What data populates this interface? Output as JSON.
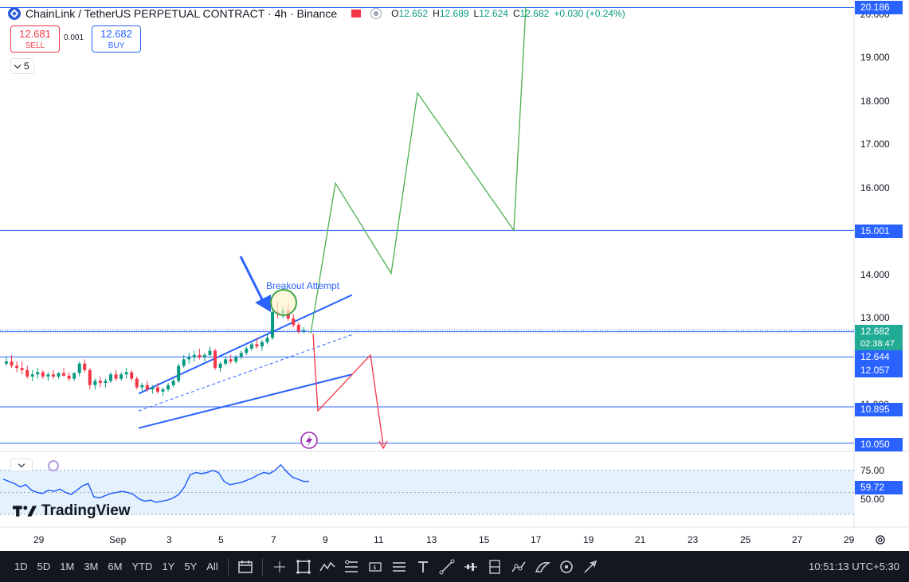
{
  "header": {
    "symbol_title": "ChainLink / TetherUS PERPETUAL CONTRACT · 4h · Binance",
    "ohlc": [
      {
        "label": "O",
        "value": "12.652"
      },
      {
        "label": "H",
        "value": "12.689"
      },
      {
        "label": "L",
        "value": "12.624"
      },
      {
        "label": "C",
        "value": "12.682"
      }
    ],
    "change": "+0.030 (+0.24%)"
  },
  "trade": {
    "sell_price": "12.681",
    "sell_label": "SELL",
    "spread": "0.001",
    "buy_price": "12.682",
    "buy_label": "BUY"
  },
  "interval_count": "5",
  "annotation": "Breakout Attempt",
  "price_axis": {
    "ticks": [
      "20.000",
      "19.000",
      "18.000",
      "17.000",
      "16.000",
      "14.000",
      "13.000",
      "11.000",
      "10.050"
    ],
    "tag_top": "20.186",
    "tag_15": "15.001",
    "tag_current": "12.682",
    "countdown": "02:38:47",
    "tag_12644": "12.644",
    "tag_12057": "12.057",
    "tag_10895": "10.895",
    "tag_10050": "10.050"
  },
  "rsi": {
    "tick_75": "75.00",
    "tick_50": "50.00",
    "value": "59.72",
    "value_color": "#2962ff",
    "band_color": "#e3f2fd"
  },
  "brand": {
    "name": "TradingView"
  },
  "time_axis": [
    "29",
    "Sep",
    "3",
    "5",
    "7",
    "9",
    "11",
    "13",
    "15",
    "17",
    "19",
    "21",
    "23",
    "25",
    "27",
    "29"
  ],
  "toolbar": {
    "timeframes": [
      "1D",
      "5D",
      "1M",
      "3M",
      "6M",
      "YTD",
      "1Y",
      "5Y",
      "All"
    ],
    "clock": "10:51:13 UTC+5:30",
    "tools": [
      "calendar-range-icon",
      "cursor-icon",
      "crosshair-select-icon",
      "trendline-pattern-icon",
      "fib-retracement-icon",
      "parallel-channel-icon",
      "gann-fan-icon",
      "text-tool-icon",
      "line-tool-icon",
      "forecast-icon",
      "position-icon",
      "path-icon",
      "brush-icon",
      "measure-icon",
      "arrow-tool-icon"
    ]
  },
  "colors": {
    "up": "#089981",
    "down": "#f23645",
    "accent": "#2962ff",
    "projection_up": "#4caf50",
    "projection_down": "#f23645"
  },
  "chart_data": {
    "type": "candlestick",
    "symbol": "ChainLink / TetherUS PERPETUAL CONTRACT",
    "interval": "4h",
    "exchange": "Binance",
    "ylim": [
      9.95,
      20.25
    ],
    "horizontal_levels": [
      20.186,
      15.001,
      12.644,
      12.057,
      10.895,
      10.05
    ],
    "channel_upper": [
      [
        11.2,
        13.3
      ],
      [
        13.0,
        13.5
      ]
    ],
    "channel_lower": [
      [
        11.35,
        12.5
      ],
      [
        10.4,
        11.65
      ]
    ],
    "projection_up_path": [
      12.6,
      16.1,
      14.0,
      18.2,
      15.0,
      20.2
    ],
    "projection_down_path": [
      12.6,
      10.8,
      12.1,
      10.0
    ],
    "candles": [
      [
        11.9,
        12.05,
        11.85,
        11.95
      ],
      [
        11.95,
        12.1,
        11.8,
        11.85
      ],
      [
        11.85,
        11.95,
        11.7,
        11.8
      ],
      [
        11.8,
        11.95,
        11.65,
        11.75
      ],
      [
        11.75,
        11.85,
        11.55,
        11.6
      ],
      [
        11.6,
        11.75,
        11.5,
        11.65
      ],
      [
        11.65,
        11.8,
        11.55,
        11.7
      ],
      [
        11.7,
        11.75,
        11.55,
        11.6
      ],
      [
        11.6,
        11.7,
        11.5,
        11.65
      ],
      [
        11.65,
        11.75,
        11.55,
        11.6
      ],
      [
        11.6,
        11.7,
        11.55,
        11.68
      ],
      [
        11.68,
        11.8,
        11.6,
        11.62
      ],
      [
        11.62,
        11.7,
        11.5,
        11.55
      ],
      [
        11.55,
        11.7,
        11.5,
        11.68
      ],
      [
        11.68,
        11.95,
        11.6,
        11.9
      ],
      [
        11.9,
        12.0,
        11.7,
        11.75
      ],
      [
        11.75,
        11.8,
        11.3,
        11.4
      ],
      [
        11.4,
        11.55,
        11.3,
        11.5
      ],
      [
        11.5,
        11.6,
        11.35,
        11.45
      ],
      [
        11.45,
        11.55,
        11.35,
        11.5
      ],
      [
        11.5,
        11.7,
        11.45,
        11.65
      ],
      [
        11.65,
        11.75,
        11.5,
        11.55
      ],
      [
        11.55,
        11.7,
        11.5,
        11.65
      ],
      [
        11.65,
        11.8,
        11.55,
        11.7
      ],
      [
        11.7,
        11.75,
        11.5,
        11.55
      ],
      [
        11.55,
        11.6,
        11.3,
        11.35
      ],
      [
        11.35,
        11.45,
        11.25,
        11.4
      ],
      [
        11.4,
        11.5,
        11.25,
        11.3
      ],
      [
        11.3,
        11.4,
        11.2,
        11.35
      ],
      [
        11.35,
        11.45,
        11.2,
        11.25
      ],
      [
        11.25,
        11.35,
        11.15,
        11.3
      ],
      [
        11.3,
        11.45,
        11.25,
        11.4
      ],
      [
        11.4,
        11.55,
        11.35,
        11.5
      ],
      [
        11.5,
        11.9,
        11.45,
        11.85
      ],
      [
        11.85,
        12.1,
        11.8,
        12.0
      ],
      [
        12.0,
        12.15,
        11.9,
        12.05
      ],
      [
        12.05,
        12.2,
        11.95,
        12.1
      ],
      [
        12.1,
        12.25,
        12.0,
        12.05
      ],
      [
        12.05,
        12.15,
        11.95,
        12.1
      ],
      [
        12.1,
        12.3,
        12.05,
        12.2
      ],
      [
        12.2,
        12.25,
        11.75,
        11.8
      ],
      [
        11.8,
        11.95,
        11.7,
        11.9
      ],
      [
        11.9,
        12.05,
        11.85,
        12.0
      ],
      [
        12.0,
        12.1,
        11.9,
        11.95
      ],
      [
        11.95,
        12.1,
        11.9,
        12.05
      ],
      [
        12.05,
        12.2,
        12.0,
        12.15
      ],
      [
        12.15,
        12.3,
        12.1,
        12.25
      ],
      [
        12.25,
        12.4,
        12.2,
        12.35
      ],
      [
        12.35,
        12.5,
        12.25,
        12.3
      ],
      [
        12.3,
        12.45,
        12.2,
        12.4
      ],
      [
        12.4,
        12.6,
        12.35,
        12.5
      ],
      [
        12.5,
        13.2,
        12.45,
        13.1
      ],
      [
        13.1,
        13.35,
        12.95,
        13.05
      ],
      [
        13.05,
        13.25,
        12.95,
        13.15
      ],
      [
        13.15,
        13.3,
        12.9,
        12.95
      ],
      [
        12.95,
        13.05,
        12.75,
        12.8
      ],
      [
        12.8,
        12.85,
        12.6,
        12.65
      ],
      [
        12.65,
        12.75,
        12.6,
        12.682
      ]
    ],
    "rsi": {
      "name": "RSI",
      "overbought": 70,
      "oversold": 30,
      "last": 59.72,
      "values": [
        62,
        60,
        58,
        55,
        57,
        52,
        50,
        49,
        52,
        51,
        53,
        50,
        48,
        52,
        56,
        58,
        46,
        45,
        47,
        49,
        50,
        51,
        50,
        48,
        44,
        42,
        43,
        41,
        42,
        43,
        45,
        48,
        55,
        66,
        68,
        67,
        68,
        70,
        68,
        60,
        57,
        58,
        59,
        61,
        63,
        66,
        68,
        67,
        70,
        75,
        69,
        64,
        62,
        60,
        60
      ]
    }
  }
}
